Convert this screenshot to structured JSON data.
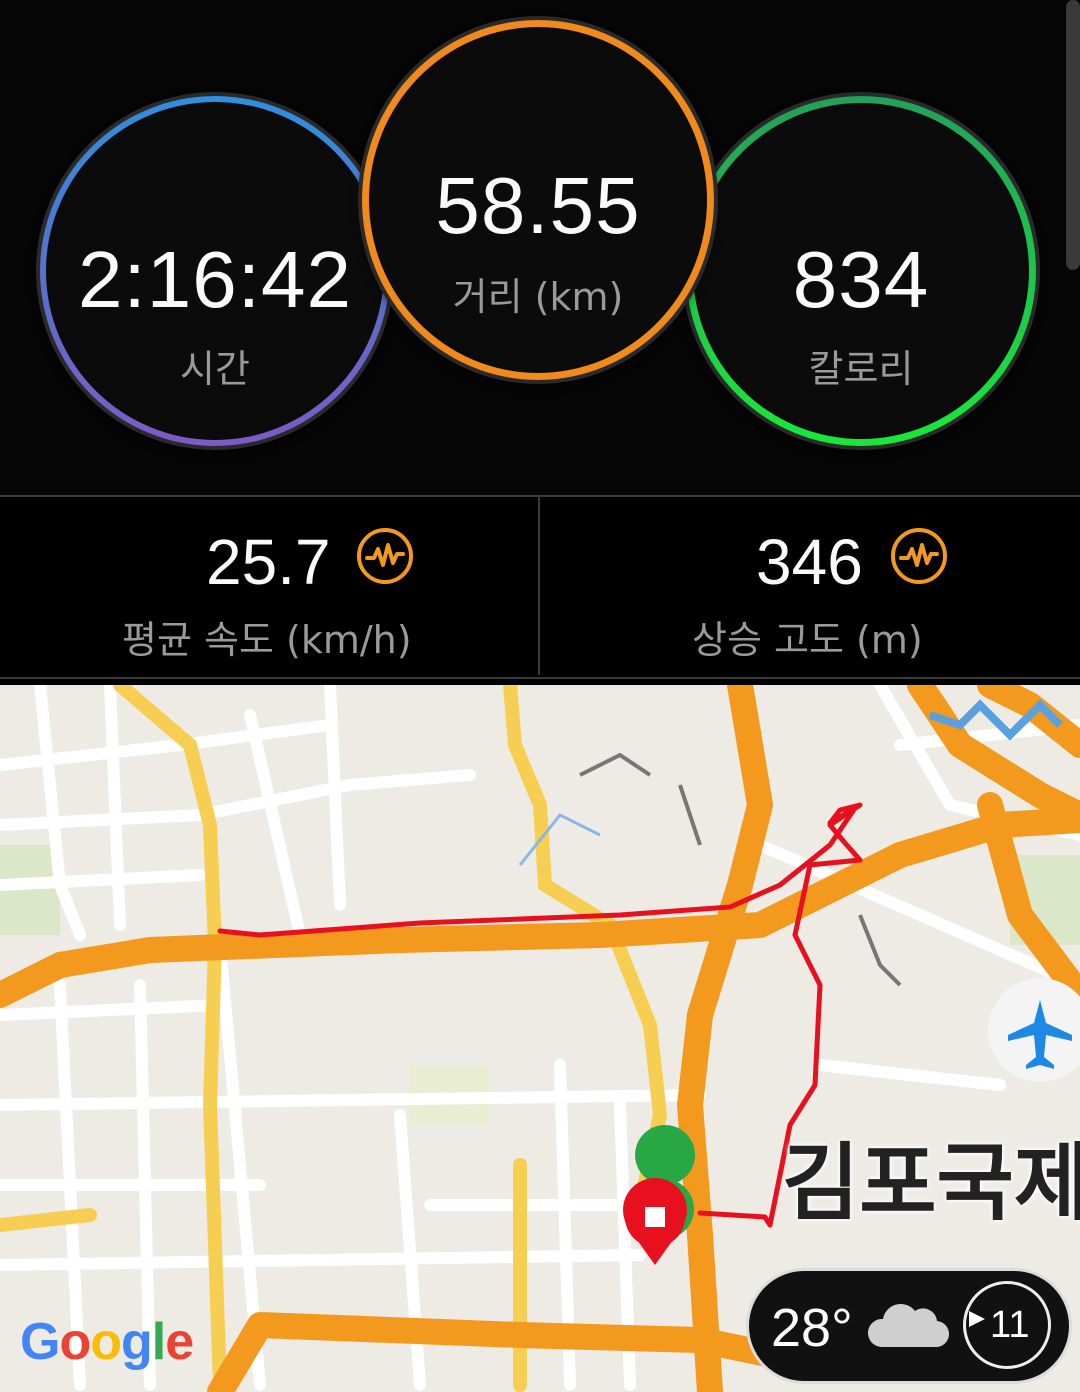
{
  "summary": {
    "time": {
      "value": "2:16:42",
      "label": "시간"
    },
    "distance": {
      "value": "58.55",
      "label": "거리 (km)"
    },
    "calories": {
      "value": "834",
      "label": "칼로리"
    }
  },
  "stats": {
    "avg_speed": {
      "value": "25.7",
      "label": "평균 속도 (km/h)"
    },
    "elevation_gain": {
      "value": "346",
      "label": "상승 고도 (m)"
    }
  },
  "map": {
    "airport_label": "김포국제",
    "google_letters": [
      "G",
      "o",
      "o",
      "g",
      "l",
      "e"
    ]
  },
  "weather": {
    "temperature": "28°",
    "icon": "cloud-icon",
    "next_value": "11"
  },
  "colors": {
    "time_ring_top": "#2f8fde",
    "time_ring_bottom": "#7b5bc7",
    "distance_ring": "#f08a1c",
    "calorie_ring": "#19e83a",
    "route": "#e8101e",
    "road_major": "#f39a1e",
    "road_minor": "#f6cf52"
  }
}
